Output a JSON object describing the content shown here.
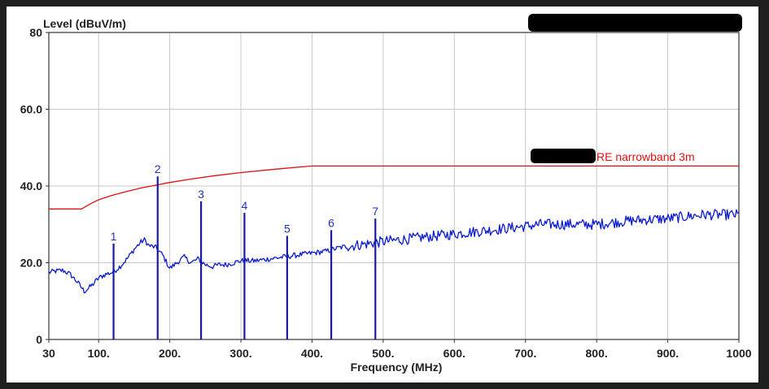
{
  "chart_data": {
    "type": "line",
    "title": "",
    "ylabel": "Level (dBuV/m)",
    "xlabel": "Frequency (MHz)",
    "xlim": [
      30,
      1000
    ],
    "ylim": [
      0,
      80
    ],
    "grid": true,
    "x_ticks": [
      30,
      100,
      200,
      300,
      400,
      500,
      600,
      700,
      800,
      900,
      1000
    ],
    "x_tick_labels": [
      "30",
      "100.",
      "200.",
      "300.",
      "400.",
      "500.",
      "600.",
      "700.",
      "800.",
      "900.",
      "1000"
    ],
    "y_ticks": [
      0,
      20,
      40,
      60,
      80
    ],
    "y_tick_labels": [
      "0",
      "20.0",
      "40.0",
      "60.0",
      "80"
    ],
    "colors": {
      "limit": "#e01010",
      "trace": "#0a1ad0",
      "markers": "#1a1aa0",
      "grid": "#c8c8c8"
    },
    "series": [
      {
        "name": "RE narrowband 3m",
        "x": [
          30,
          76,
          88,
          100,
          120,
          140,
          160,
          180,
          200,
          230,
          260,
          300,
          350,
          400,
          1000
        ],
        "y": [
          34,
          34,
          35.3,
          36.4,
          37.6,
          38.6,
          39.5,
          40.2,
          40.9,
          41.8,
          42.6,
          43.5,
          44.4,
          45.2,
          45.2
        ]
      },
      {
        "x": [
          30,
          40,
          50,
          60,
          70,
          80,
          90,
          100,
          110,
          120,
          130,
          140,
          150,
          160,
          165,
          170,
          180,
          190,
          200,
          210,
          220,
          230,
          240,
          250,
          260,
          270,
          280,
          290,
          300,
          320,
          340,
          360,
          380,
          400,
          420,
          440,
          460,
          480,
          500,
          550,
          600,
          650,
          700,
          720,
          750,
          800,
          850,
          900,
          950,
          1000
        ],
        "y": [
          17.5,
          17.8,
          18,
          17,
          15,
          12.5,
          14,
          16,
          17,
          17.5,
          19,
          21,
          23.5,
          25.5,
          26,
          24.5,
          24,
          22,
          18.5,
          20,
          21.5,
          20,
          21,
          19.5,
          19,
          19.5,
          19.5,
          20,
          20.5,
          20.5,
          21,
          21.5,
          22,
          22.5,
          23,
          24,
          24.5,
          25,
          25.5,
          26.5,
          27.5,
          28.5,
          29.5,
          30,
          30,
          30,
          31,
          31.5,
          32.5,
          32.5
        ]
      }
    ],
    "markers": [
      {
        "label": "1",
        "x": 121,
        "y": 25
      },
      {
        "label": "2",
        "x": 183,
        "y": 42.5
      },
      {
        "label": "3",
        "x": 244,
        "y": 36
      },
      {
        "label": "4",
        "x": 305,
        "y": 33
      },
      {
        "label": "5",
        "x": 365,
        "y": 27
      },
      {
        "label": "6",
        "x": 427,
        "y": 28.5
      },
      {
        "label": "7",
        "x": 489,
        "y": 31.5
      }
    ]
  }
}
